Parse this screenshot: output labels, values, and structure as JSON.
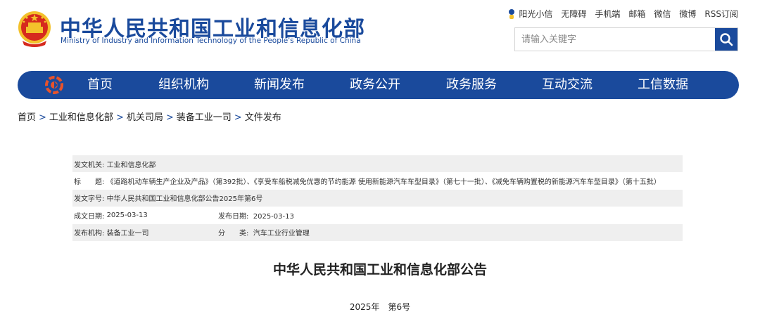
{
  "header": {
    "title": "中华人民共和国工业和信息化部",
    "subtitle": "Ministry of Industry and Information Technology of the People's Republic of China"
  },
  "toplinks": {
    "elder": "阳光小信",
    "accessible": "无障碍",
    "mobile": "手机端",
    "mail": "邮箱",
    "wechat": "微信",
    "weibo": "微博",
    "rss": "RSS订阅"
  },
  "search": {
    "placeholder": "请输入关键字"
  },
  "nav": {
    "items": [
      "首页",
      "组织机构",
      "新闻发布",
      "政务公开",
      "政务服务",
      "互动交流",
      "工信数据"
    ]
  },
  "breadcrumb": [
    "首页",
    "工业和信息化部",
    "机关司局",
    "装备工业一司",
    "文件发布"
  ],
  "breadcrumb_sep": ">",
  "info": {
    "issuer_label": "发文机关:",
    "issuer": "工业和信息化部",
    "title_label": "标　　题:",
    "title": "《道路机动车辆生产企业及产品》（第392批）、《享受车船税减免优惠的节约能源 使用新能源汽车车型目录》（第七十一批）、《减免车辆购置税的新能源汽车车型目录》（第十五批）",
    "docno_label": "发文字号:",
    "docno": "中华人民共和国工业和信息化部公告2025年第6号",
    "written_label": "成文日期:",
    "written": "2025-03-13",
    "published_label": "发布日期:",
    "published": "2025-03-13",
    "agency_label": "发布机构:",
    "agency": "装备工业一司",
    "category_label": "分　　类:",
    "category": "汽车工业行业管理"
  },
  "document": {
    "title": "中华人民共和国工业和信息化部公告",
    "number": "2025年　第6号"
  },
  "colors": {
    "brand": "#1a4a9c",
    "row_shade": "#efefef",
    "emblem_red": "#d62a1e",
    "emblem_gold": "#f3c12b"
  }
}
